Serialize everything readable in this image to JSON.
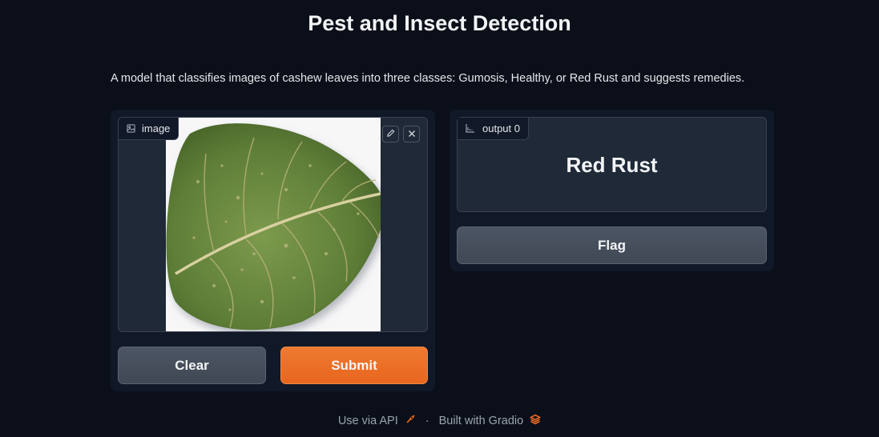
{
  "app": {
    "title": "Pest and Insect Detection",
    "description": "A model that classifies images of cashew leaves into three classes: Gumosis, Healthy, or Red Rust and suggests remedies."
  },
  "input": {
    "label": "image",
    "icon": "image-icon",
    "clear_label": "Clear",
    "submit_label": "Submit"
  },
  "output": {
    "label": "output 0",
    "icon": "bar-chart-icon",
    "value": "Red Rust",
    "flag_label": "Flag"
  },
  "footer": {
    "api_label": "Use via API",
    "separator": "·",
    "built_with": "Built with Gradio"
  },
  "colors": {
    "background": "#0b0f19",
    "panel": "#111827",
    "accent": "#e8661f",
    "secondary_button": "#4b5563"
  }
}
